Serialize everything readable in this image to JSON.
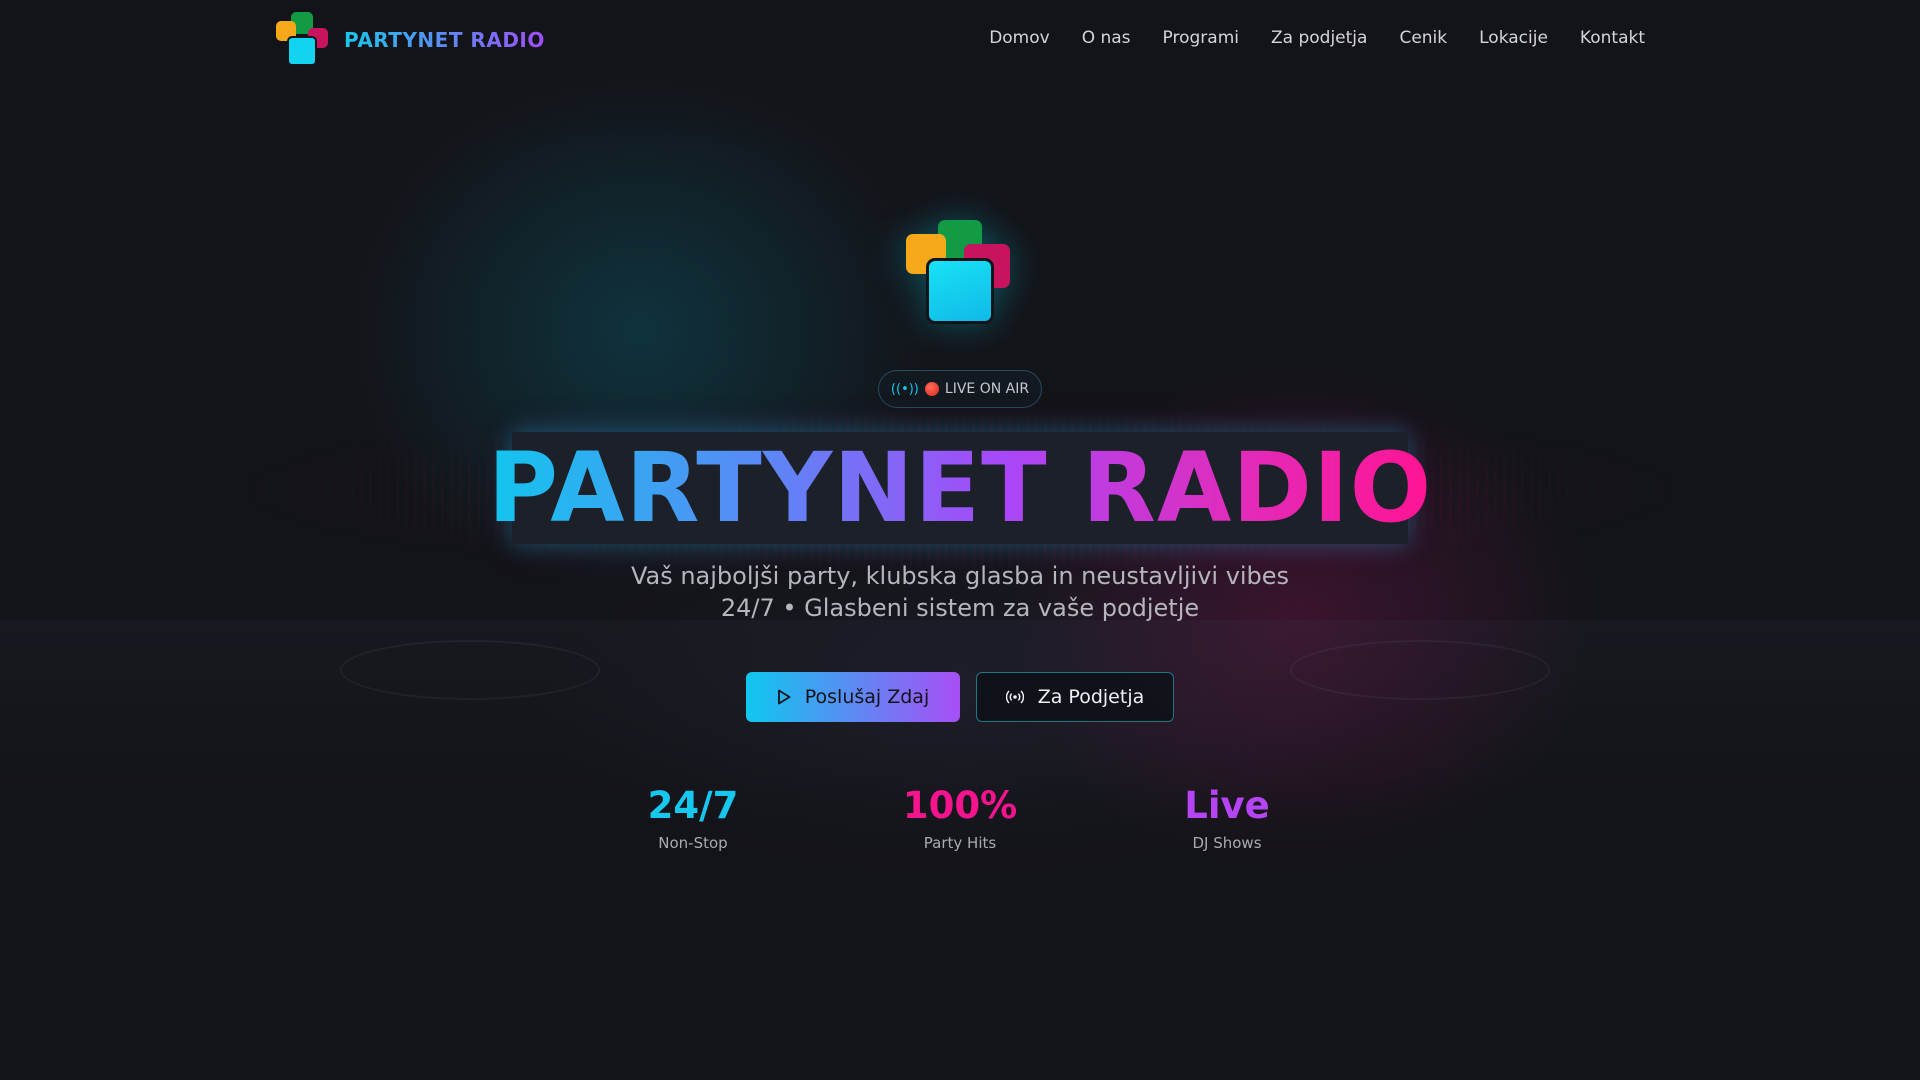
{
  "brand": {
    "name": "PARTYNET RADIO",
    "logo_icon": "colored-squares-logo"
  },
  "nav": {
    "items": [
      {
        "label": "Domov"
      },
      {
        "label": "O nas"
      },
      {
        "label": "Programi"
      },
      {
        "label": "Za podjetja"
      },
      {
        "label": "Cenik"
      },
      {
        "label": "Lokacije"
      },
      {
        "label": "Kontakt"
      }
    ]
  },
  "hero": {
    "badge": {
      "icon": "radio-waves-icon",
      "dot": "red-dot",
      "label": "LIVE ON AIR"
    },
    "title": "PARTYNET RADIO",
    "subtitle_line1": "Vaš najboljši party, klubska glasba in neustavljivi vibes",
    "subtitle_line2": "24/7 • Glasbeni sistem za vaše podjetje",
    "buttons": {
      "listen": {
        "label": "Poslušaj Zdaj",
        "icon": "play-icon"
      },
      "business": {
        "label": "Za Podjetja",
        "icon": "radio-waves-icon"
      }
    }
  },
  "stats": [
    {
      "value": "24/7",
      "label": "Non-Stop",
      "color": "#16c7ee"
    },
    {
      "value": "100%",
      "label": "Party Hits",
      "color": "#f5148e"
    },
    {
      "value": "Live",
      "label": "DJ Shows",
      "color": "#b544f4"
    }
  ],
  "colors": {
    "background": "#131419",
    "cyan": "#16c7ee",
    "purple": "#a84ef6",
    "pink": "#f5148e",
    "logo_green": "#139a45",
    "logo_yellow": "#f5a81a",
    "logo_magenta": "#c8135f",
    "logo_cyan": "#12d3f0"
  }
}
